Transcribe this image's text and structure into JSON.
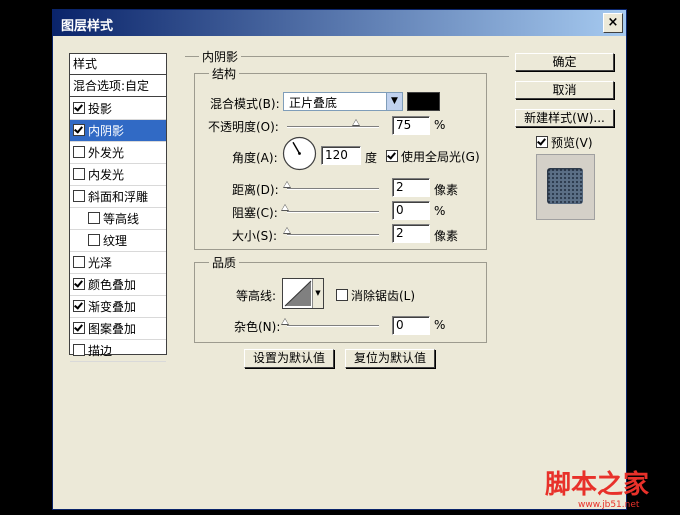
{
  "window": {
    "title": "图层样式",
    "close_icon": "×"
  },
  "style_list": {
    "header": "样式",
    "blend_options": "混合选项:自定",
    "items": [
      {
        "label": "投影",
        "checked": true,
        "selected": false,
        "sub": false
      },
      {
        "label": "内阴影",
        "checked": true,
        "selected": true,
        "sub": false
      },
      {
        "label": "外发光",
        "checked": false,
        "selected": false,
        "sub": false
      },
      {
        "label": "内发光",
        "checked": false,
        "selected": false,
        "sub": false
      },
      {
        "label": "斜面和浮雕",
        "checked": false,
        "selected": false,
        "sub": false
      },
      {
        "label": "等高线",
        "checked": false,
        "selected": false,
        "sub": true
      },
      {
        "label": "纹理",
        "checked": false,
        "selected": false,
        "sub": true
      },
      {
        "label": "光泽",
        "checked": false,
        "selected": false,
        "sub": false
      },
      {
        "label": "颜色叠加",
        "checked": true,
        "selected": false,
        "sub": false
      },
      {
        "label": "渐变叠加",
        "checked": true,
        "selected": false,
        "sub": false
      },
      {
        "label": "图案叠加",
        "checked": true,
        "selected": false,
        "sub": false
      },
      {
        "label": "描边",
        "checked": false,
        "selected": false,
        "sub": false
      }
    ]
  },
  "panel": {
    "title": "内阴影",
    "structure": {
      "legend": "结构",
      "blend_mode_label": "混合模式(B):",
      "blend_mode_value": "正片叠底",
      "shadow_color": "#000000",
      "opacity_label": "不透明度(O):",
      "opacity_value": "75",
      "opacity_unit": "%",
      "opacity_fraction": 0.75,
      "angle_label": "角度(A):",
      "angle_value": "120",
      "angle_unit": "度",
      "global_light_label": "使用全局光(G)",
      "global_light_checked": true,
      "distance_label": "距离(D):",
      "distance_value": "2",
      "distance_unit": "像素",
      "choke_label": "阻塞(C):",
      "choke_value": "0",
      "choke_unit": "%",
      "size_label": "大小(S):",
      "size_value": "2",
      "size_unit": "像素"
    },
    "quality": {
      "legend": "品质",
      "contour_label": "等高线:",
      "antialias_label": "消除锯齿(L)",
      "antialias_checked": false,
      "noise_label": "杂色(N):",
      "noise_value": "0",
      "noise_unit": "%"
    },
    "set_default_button": "设置为默认值",
    "reset_default_button": "复位为默认值"
  },
  "right": {
    "ok_button": "确定",
    "cancel_button": "取消",
    "new_style_button": "新建样式(W)...",
    "preview_label": "预览(V)",
    "preview_checked": true
  },
  "watermark": {
    "text": "脚本之家",
    "url": "www.jb51.net",
    "color": "#e8312a"
  }
}
